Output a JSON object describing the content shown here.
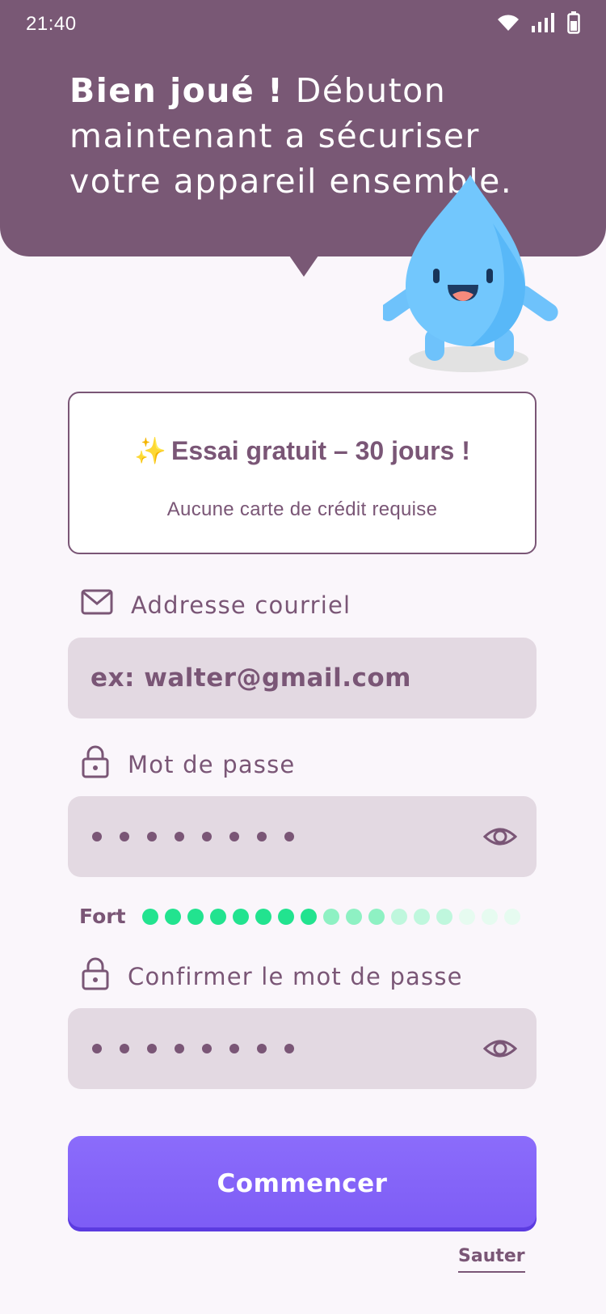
{
  "status_bar": {
    "time": "21:40",
    "icons": [
      "wifi-icon",
      "signal-icon",
      "battery-icon"
    ]
  },
  "header": {
    "headline_bold": "Bien joué !",
    "headline_rest": " Débuton maintenant a sécuriser votre appareil ensemble.",
    "background_color": "#795875"
  },
  "trial": {
    "sparkle": "✨",
    "title": "Essai gratuit – 30 jours !",
    "subtitle": "Aucune carte de crédit requise"
  },
  "email": {
    "label": "Addresse courriel",
    "placeholder": "ex: walter@gmail.com",
    "icon": "mail-icon"
  },
  "password": {
    "label": "Mot de passe",
    "masked_length": 8,
    "icon": "lock-icon"
  },
  "strength": {
    "label": "Fort",
    "levels": [
      1,
      1,
      1,
      1,
      1,
      1,
      1,
      1,
      2,
      2,
      2,
      3,
      3,
      3,
      4,
      4,
      4
    ]
  },
  "confirm_password": {
    "label": "Confirmer le mot de passe",
    "masked_length": 8,
    "icon": "lock-icon"
  },
  "cta": {
    "label": "Commencer",
    "color": "#7d5cf5"
  },
  "skip": {
    "label": "Sauter"
  },
  "colors": {
    "primary_text": "#7a5676",
    "field_bg": "#e3d9e2",
    "strength_strong": "#22e38f",
    "page_bg": "#faf6fb"
  }
}
